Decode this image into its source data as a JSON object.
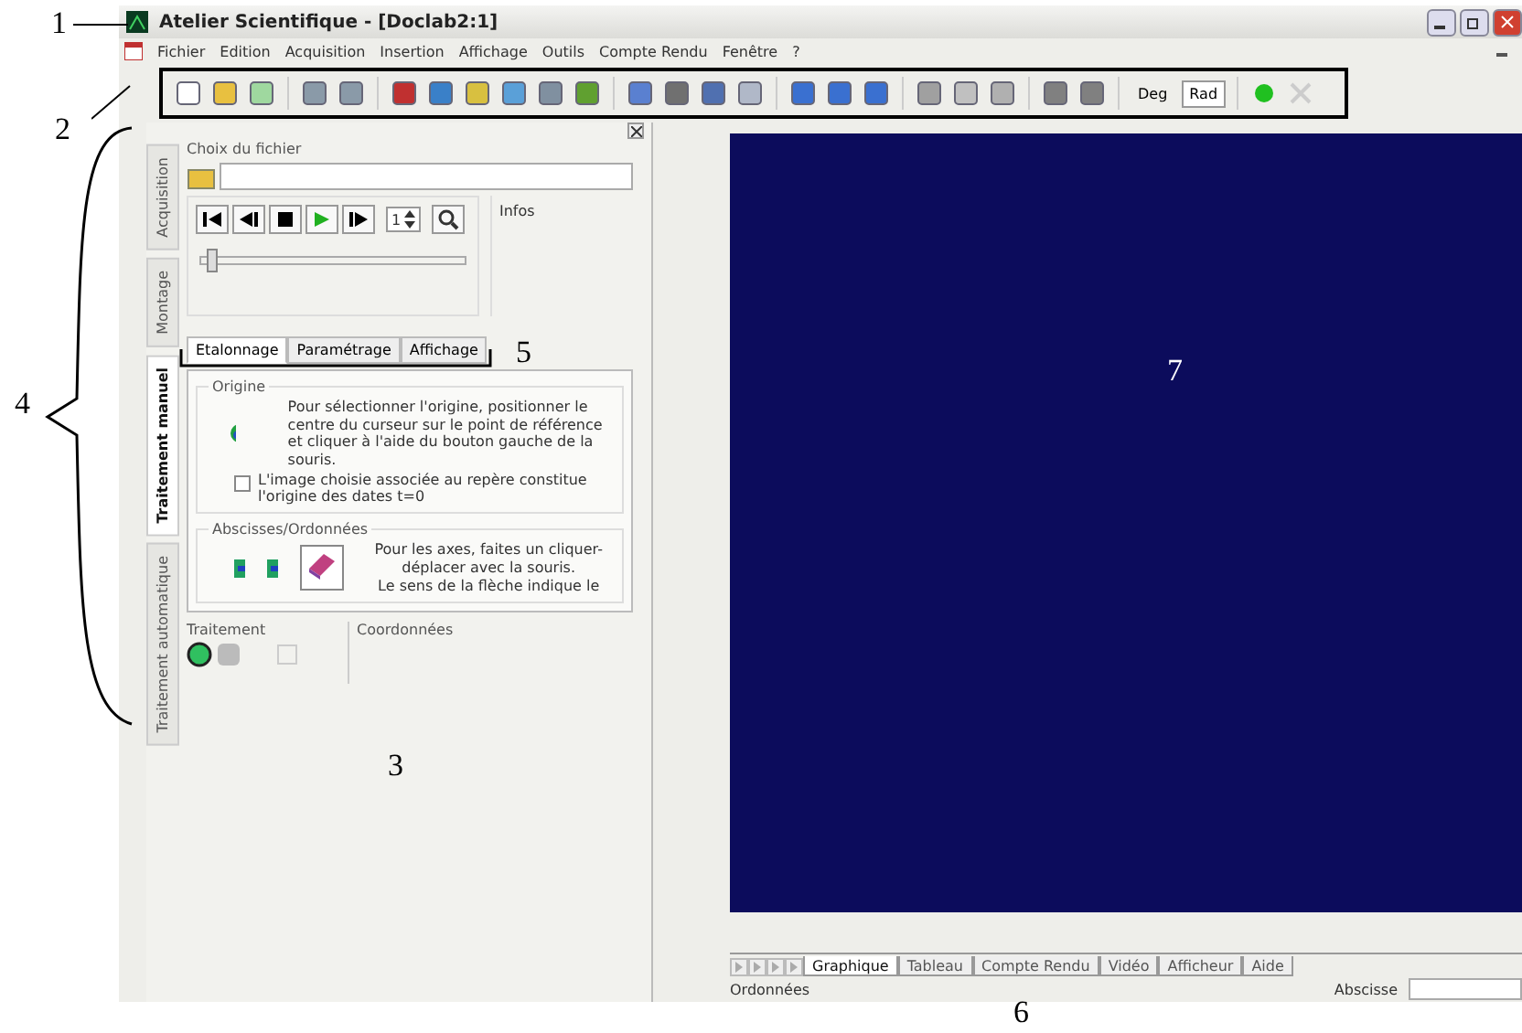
{
  "window": {
    "title": "Atelier Scientifique - [Doclab2:1]"
  },
  "menu": [
    "Fichier",
    "Edition",
    "Acquisition",
    "Insertion",
    "Affichage",
    "Outils",
    "Compte Rendu",
    "Fenêtre",
    "?"
  ],
  "toolbar": {
    "deg_label": "Deg",
    "rad_label": "Rad",
    "rad_selected": true
  },
  "side_tabs": [
    {
      "label": "Acquisition",
      "selected": false
    },
    {
      "label": "Montage",
      "selected": false
    },
    {
      "label": "Traitement manuel",
      "selected": true
    },
    {
      "label": "Traitement automatique",
      "selected": false
    }
  ],
  "file_group": {
    "title": "Choix du fichier",
    "spin_value": "1",
    "infos_label": "Infos",
    "slider": {
      "level": 0.02
    }
  },
  "inner_tabs": [
    {
      "label": "Etalonnage",
      "selected": true
    },
    {
      "label": "Paramétrage",
      "selected": false
    },
    {
      "label": "Affichage",
      "selected": false
    }
  ],
  "origin": {
    "title": "Origine",
    "text": "Pour sélectionner l'origine, positionner le centre du curseur sur le point de référence et cliquer à l'aide du bouton gauche de la souris.",
    "checkbox_label": "L'image choisie associée au repère constitue l'origine des dates t=0",
    "checked": false
  },
  "axes": {
    "title": "Abscisses/Ordonnées",
    "text": "Pour les axes, faites un cliquer-déplacer avec la souris.\nLe sens de la flèche indique le"
  },
  "traitement": {
    "title": "Traitement",
    "coords_title": "Coordonnées"
  },
  "bottom_tabs": [
    {
      "label": "Graphique",
      "selected": true
    },
    {
      "label": "Tableau",
      "selected": false
    },
    {
      "label": "Compte Rendu",
      "selected": false
    },
    {
      "label": "Vidéo",
      "selected": false
    },
    {
      "label": "Afficheur",
      "selected": false
    },
    {
      "label": "Aide",
      "selected": false
    }
  ],
  "status": {
    "left": "Ordonnées",
    "abscissa_label": "Abscisse"
  },
  "annotations": [
    "1",
    "2",
    "3",
    "4",
    "5",
    "6",
    "7"
  ]
}
